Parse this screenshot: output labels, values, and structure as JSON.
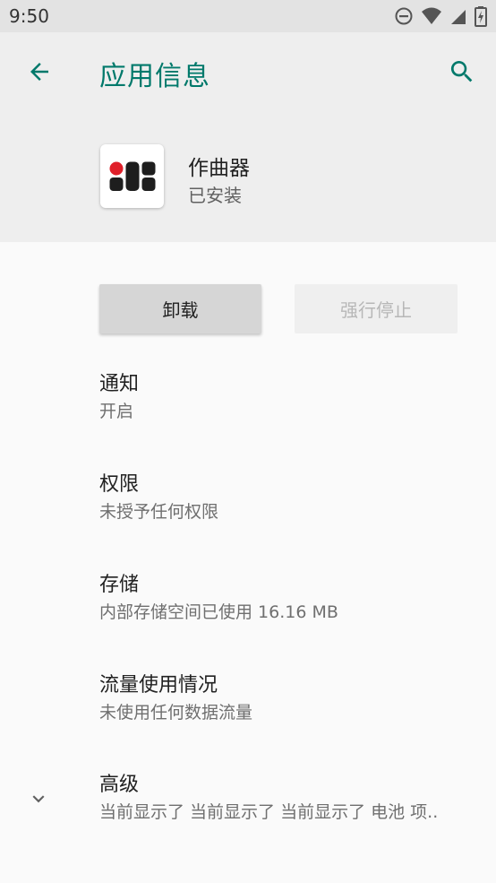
{
  "status_bar": {
    "time": "9:50",
    "icons": [
      "dnd-icon",
      "wifi-icon",
      "signal-icon",
      "battery-icon"
    ]
  },
  "app_bar": {
    "title": "应用信息",
    "back_icon": "arrow-left-icon",
    "search_icon": "search-icon",
    "accent_color": "#00796b"
  },
  "app": {
    "name": "作曲器",
    "status": "已安装",
    "icon": "app-logo-icon"
  },
  "buttons": {
    "uninstall": "卸载",
    "force_stop": "强行停止"
  },
  "items": [
    {
      "title": "通知",
      "sub": "开启"
    },
    {
      "title": "权限",
      "sub": "未授予任何权限"
    },
    {
      "title": "存储",
      "sub": "内部存储空间已使用 16.16 MB"
    },
    {
      "title": "流量使用情况",
      "sub": "未使用任何数据流量"
    },
    {
      "title": "高级",
      "sub": "当前显示了 当前显示了 当前显示了 电池 项.."
    }
  ]
}
